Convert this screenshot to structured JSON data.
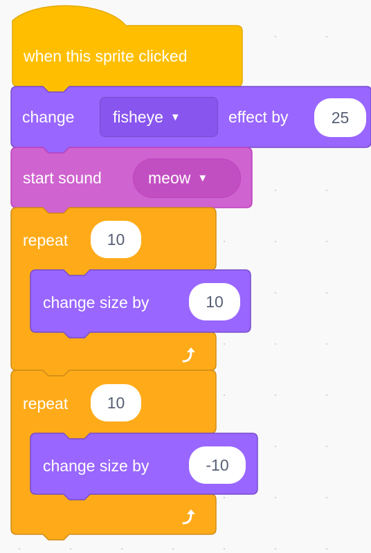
{
  "colors": {
    "events": "#ffbf00",
    "events_dark": "#e6a800",
    "looks": "#9966ff",
    "looks_dark": "#774dcb",
    "sound": "#cf63cf",
    "sound_dark": "#bd42bd",
    "control": "#ffab19",
    "control_dark": "#cf8b17"
  },
  "blocks": {
    "hat": {
      "label": "when this sprite clicked"
    },
    "effect": {
      "label": "change",
      "dropdown": "fisheye",
      "label2": "effect by",
      "value": "25"
    },
    "sound": {
      "label": "start sound",
      "dropdown": "meow"
    },
    "repeat1": {
      "label": "repeat",
      "times": "10",
      "inner": {
        "label": "change size by",
        "value": "10"
      }
    },
    "repeat2": {
      "label": "repeat",
      "times": "10",
      "inner": {
        "label": "change size by",
        "value": "-10"
      }
    }
  },
  "icons": {
    "dropdown_caret": "triangle-down",
    "loop_arrow": "loop-arrow-icon"
  }
}
